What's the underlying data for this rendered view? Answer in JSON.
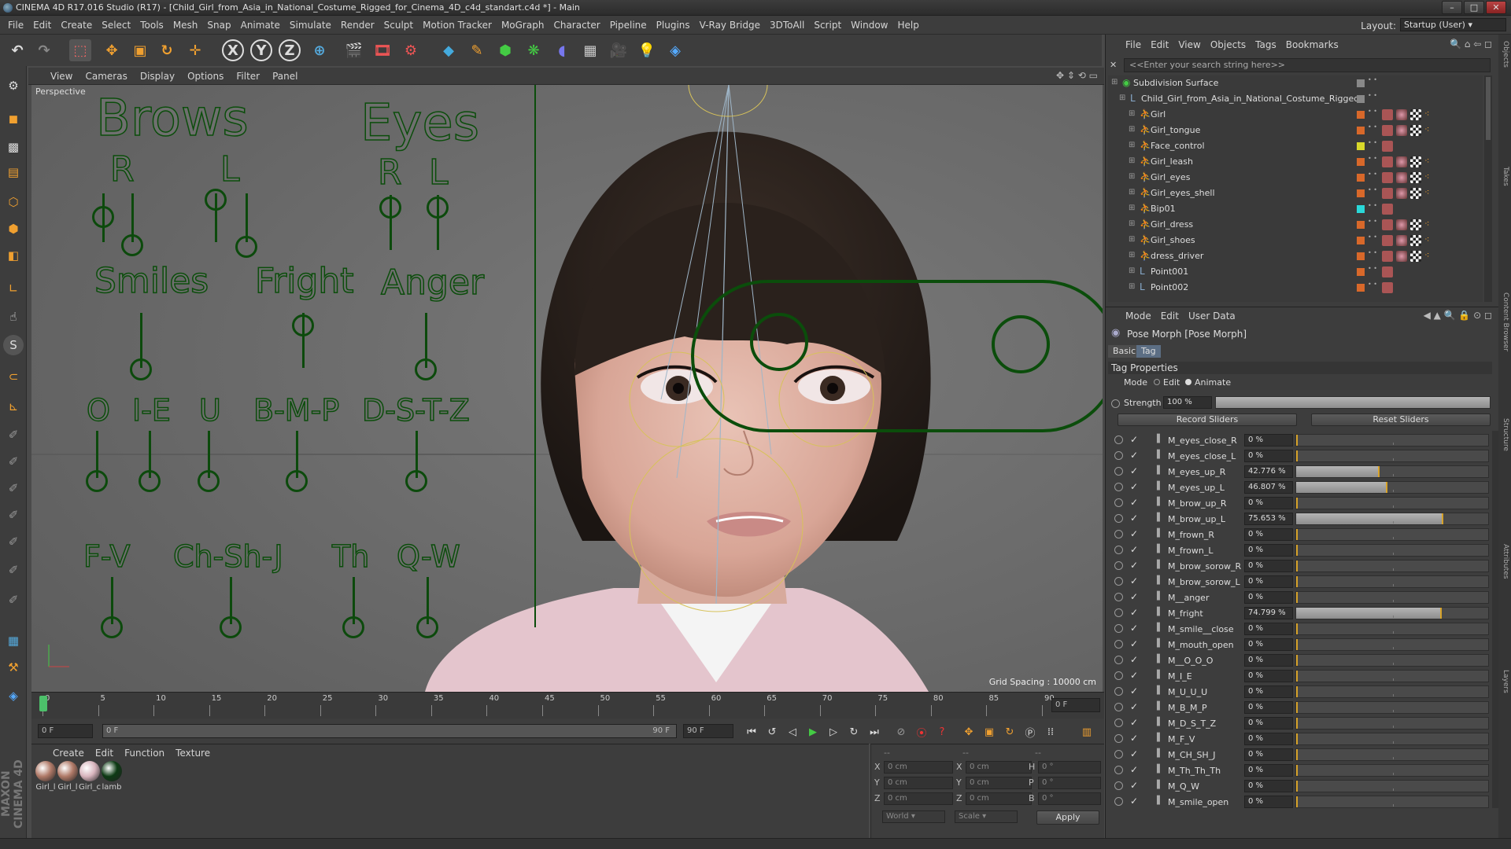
{
  "window": {
    "title": "CINEMA 4D R17.016 Studio (R17) - [Child_Girl_from_Asia_in_National_Costume_Rigged_for_Cinema_4D_c4d_standart.c4d *] - Main",
    "min": "–",
    "max": "□",
    "close": "✕"
  },
  "menubar": {
    "items": [
      "File",
      "Edit",
      "Create",
      "Select",
      "Tools",
      "Mesh",
      "Snap",
      "Animate",
      "Simulate",
      "Render",
      "Sculpt",
      "Motion Tracker",
      "MoGraph",
      "Character",
      "Pipeline",
      "Plugins",
      "V-Ray Bridge",
      "3DToAll",
      "Script",
      "Window",
      "Help"
    ],
    "layout_label": "Layout:",
    "layout_value": "Startup (User)"
  },
  "toolbar": {
    "x": "X",
    "y": "Y",
    "z": "Z"
  },
  "viewport": {
    "menu": [
      "View",
      "Cameras",
      "Display",
      "Options",
      "Filter",
      "Panel"
    ],
    "label": "Perspective",
    "grid_spacing": "Grid Spacing : 10000 cm",
    "rig": {
      "brows": "Brows",
      "eyes": "Eyes",
      "r1": "R",
      "l1": "L",
      "r2": "R",
      "l2": "L",
      "smiles": "Smiles",
      "fright": "Fright",
      "anger": "Anger",
      "o": "O",
      "ie": "I-E",
      "u": "U",
      "bmp": "B-M-P",
      "dstz": "D-S-T-Z",
      "fv": "F-V",
      "chshj": "Ch-Sh-J",
      "th": "Th",
      "qw": "Q-W"
    }
  },
  "timeline": {
    "ticks": [
      "0",
      "5",
      "10",
      "15",
      "20",
      "25",
      "30",
      "35",
      "40",
      "45",
      "50",
      "55",
      "60",
      "65",
      "70",
      "75",
      "80",
      "85",
      "90"
    ],
    "current_frame": "0 F"
  },
  "transport": {
    "start": "0 F",
    "range_start": "0 F",
    "range_end": "90 F",
    "end": "90 F"
  },
  "materials": {
    "menu": [
      "Create",
      "Edit",
      "Function",
      "Texture"
    ],
    "items": [
      {
        "label": "Girl_l",
        "color": "#b07a68"
      },
      {
        "label": "Girl_l",
        "color": "#b07a68"
      },
      {
        "label": "Girl_c",
        "color": "#d8b4bd"
      },
      {
        "label": "lamb",
        "color": "#0d3a14"
      }
    ]
  },
  "coords": {
    "header": [
      "--",
      "--",
      "--"
    ],
    "rows": [
      {
        "a": "X",
        "av": "0 cm",
        "b": "X",
        "bv": "0 cm",
        "c": "H",
        "cv": "0 °"
      },
      {
        "a": "Y",
        "av": "0 cm",
        "b": "Y",
        "bv": "0 cm",
        "c": "P",
        "cv": "0 °"
      },
      {
        "a": "Z",
        "av": "0 cm",
        "b": "Z",
        "bv": "0 cm",
        "c": "B",
        "cv": "0 °"
      }
    ],
    "world": "World",
    "scale": "Scale",
    "apply": "Apply"
  },
  "object_manager": {
    "menu": [
      "File",
      "Edit",
      "View",
      "Objects",
      "Tags",
      "Bookmarks"
    ],
    "search_placeholder": "<<Enter your search string here>>",
    "rows": [
      {
        "name": "Subdivision Surface",
        "color": "#888888"
      },
      {
        "name": "Child_Girl_from_Asia_in_National_Costume_Rigged",
        "color": "#888888"
      },
      {
        "name": "Girl",
        "color": "#d8682a"
      },
      {
        "name": "Girl_tongue",
        "color": "#d8682a"
      },
      {
        "name": "Face_control",
        "color": "#d8d82a"
      },
      {
        "name": "Girl_leash",
        "color": "#d8682a"
      },
      {
        "name": "Girl_eyes",
        "color": "#d8682a"
      },
      {
        "name": "Girl_eyes_shell",
        "color": "#d8682a"
      },
      {
        "name": "Bip01",
        "color": "#2ad8d8"
      },
      {
        "name": "Girl_dress",
        "color": "#d8682a"
      },
      {
        "name": "Girl_shoes",
        "color": "#d8682a"
      },
      {
        "name": "dress_driver",
        "color": "#d8682a"
      },
      {
        "name": "Point001",
        "color": "#d8682a"
      },
      {
        "name": "Point002",
        "color": "#d8682a"
      }
    ]
  },
  "attributes": {
    "menu": [
      "Mode",
      "Edit",
      "User Data"
    ],
    "title": "Pose Morph [Pose Morph]",
    "tabs": [
      "Basic",
      "Tag"
    ],
    "section": "Tag Properties",
    "mode_label": "Mode",
    "mode_edit": "Edit",
    "mode_animate": "Animate",
    "strength_label": "Strength",
    "strength_value": "100 %",
    "strength": 1.0,
    "record": "Record Sliders",
    "reset": "Reset Sliders",
    "morphs": [
      {
        "name": "M_eyes_close_R",
        "value": "0 %",
        "level": 0
      },
      {
        "name": "M_eyes_close_L",
        "value": "0 %",
        "level": 0
      },
      {
        "name": "M_eyes_up_R",
        "value": "42.776 %",
        "level": 0.42776
      },
      {
        "name": "M_eyes_up_L",
        "value": "46.807 %",
        "level": 0.46807
      },
      {
        "name": "M_brow_up_R",
        "value": "0 %",
        "level": 0
      },
      {
        "name": "M_brow_up_L",
        "value": "75.653 %",
        "level": 0.75653
      },
      {
        "name": "M_frown_R",
        "value": "0 %",
        "level": 0
      },
      {
        "name": "M_frown_L",
        "value": "0 %",
        "level": 0
      },
      {
        "name": "M_brow_sorow_R",
        "value": "0 %",
        "level": 0
      },
      {
        "name": "M_brow_sorow_L",
        "value": "0 %",
        "level": 0
      },
      {
        "name": "M__anger",
        "value": "0 %",
        "level": 0
      },
      {
        "name": "M_fright",
        "value": "74.799 %",
        "level": 0.74799
      },
      {
        "name": "M_smile__close",
        "value": "0 %",
        "level": 0
      },
      {
        "name": "M_mouth_open",
        "value": "0 %",
        "level": 0
      },
      {
        "name": "M__O_O_O",
        "value": "0 %",
        "level": 0
      },
      {
        "name": "M_I_E",
        "value": "0 %",
        "level": 0
      },
      {
        "name": "M_U_U_U",
        "value": "0 %",
        "level": 0
      },
      {
        "name": "M_B_M_P",
        "value": "0 %",
        "level": 0
      },
      {
        "name": "M_D_S_T_Z",
        "value": "0 %",
        "level": 0
      },
      {
        "name": "M_F_V",
        "value": "0 %",
        "level": 0
      },
      {
        "name": "M_CH_SH_J",
        "value": "0 %",
        "level": 0
      },
      {
        "name": "M_Th_Th_Th",
        "value": "0 %",
        "level": 0
      },
      {
        "name": "M_Q_W",
        "value": "0 %",
        "level": 0
      },
      {
        "name": "M_smile_open",
        "value": "0 %",
        "level": 0
      }
    ]
  },
  "sidetabs": [
    "Objects",
    "Takes",
    "Content Browser",
    "Structure",
    "Attributes",
    "Layers"
  ],
  "maxon_logo": "MAXON CINEMA 4D"
}
